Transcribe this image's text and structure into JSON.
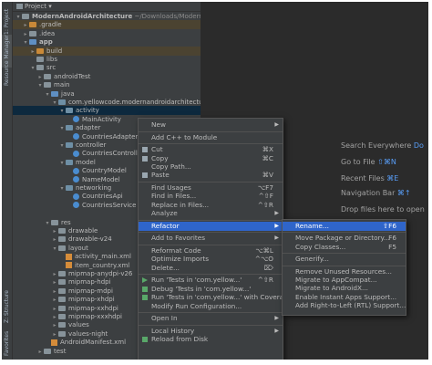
{
  "left_strip": {
    "project": "1: Project",
    "resource_manager": "Resource Manager",
    "structure": "Z: Structure",
    "favorites": "Favorites"
  },
  "panel": {
    "title": "Project"
  },
  "tree": [
    {
      "label": "ModernAndroidArchitecture",
      "extra": " ~/Downloads/ModernAndroid",
      "depth": 0,
      "arrow": "down",
      "icon": "folder",
      "bold": true
    },
    {
      "label": ".gradle",
      "depth": 1,
      "arrow": "right",
      "icon": "folder-orange",
      "dir": true
    },
    {
      "label": ".idea",
      "depth": 1,
      "arrow": "right",
      "icon": "folder"
    },
    {
      "label": "app",
      "depth": 1,
      "arrow": "down",
      "icon": "folder-blue",
      "bold": true
    },
    {
      "label": "build",
      "depth": 2,
      "arrow": "right",
      "icon": "folder-orange",
      "dir": true
    },
    {
      "label": "libs",
      "depth": 2,
      "arrow": "",
      "icon": "folder"
    },
    {
      "label": "src",
      "depth": 2,
      "arrow": "down",
      "icon": "folder"
    },
    {
      "label": "androidTest",
      "depth": 3,
      "arrow": "right",
      "icon": "folder"
    },
    {
      "label": "main",
      "depth": 3,
      "arrow": "down",
      "icon": "folder"
    },
    {
      "label": "java",
      "depth": 4,
      "arrow": "down",
      "icon": "folder-blue"
    },
    {
      "label": "com.yellowcode.modernandroidarchitecture",
      "depth": 5,
      "arrow": "down",
      "icon": "package"
    },
    {
      "label": "activity",
      "depth": 6,
      "arrow": "down",
      "icon": "package",
      "sel": true
    },
    {
      "label": "MainActivity",
      "depth": 7,
      "arrow": "",
      "icon": "class"
    },
    {
      "label": "adapter",
      "depth": 6,
      "arrow": "down",
      "icon": "package"
    },
    {
      "label": "CountriesAdapter",
      "depth": 7,
      "arrow": "",
      "icon": "class"
    },
    {
      "label": "controller",
      "depth": 6,
      "arrow": "down",
      "icon": "package"
    },
    {
      "label": "CountriesController",
      "depth": 7,
      "arrow": "",
      "icon": "class"
    },
    {
      "label": "model",
      "depth": 6,
      "arrow": "down",
      "icon": "package"
    },
    {
      "label": "CountryModel",
      "depth": 7,
      "arrow": "",
      "icon": "class"
    },
    {
      "label": "NameModel",
      "depth": 7,
      "arrow": "",
      "icon": "class"
    },
    {
      "label": "networking",
      "depth": 6,
      "arrow": "down",
      "icon": "package"
    },
    {
      "label": "CountriesApi",
      "depth": 7,
      "arrow": "",
      "icon": "class"
    },
    {
      "label": "CountriesService",
      "depth": 7,
      "arrow": "",
      "icon": "class"
    },
    {
      "label": "",
      "depth": 0,
      "arrow": "",
      "icon": ""
    },
    {
      "label": "res",
      "depth": 4,
      "arrow": "down",
      "icon": "folder"
    },
    {
      "label": "drawable",
      "depth": 5,
      "arrow": "right",
      "icon": "folder"
    },
    {
      "label": "drawable-v24",
      "depth": 5,
      "arrow": "right",
      "icon": "folder"
    },
    {
      "label": "layout",
      "depth": 5,
      "arrow": "down",
      "icon": "folder"
    },
    {
      "label": "activity_main.xml",
      "depth": 6,
      "arrow": "",
      "icon": "xml"
    },
    {
      "label": "item_country.xml",
      "depth": 6,
      "arrow": "",
      "icon": "xml"
    },
    {
      "label": "mipmap-anydpi-v26",
      "depth": 5,
      "arrow": "right",
      "icon": "folder"
    },
    {
      "label": "mipmap-hdpi",
      "depth": 5,
      "arrow": "right",
      "icon": "folder"
    },
    {
      "label": "mipmap-mdpi",
      "depth": 5,
      "arrow": "right",
      "icon": "folder"
    },
    {
      "label": "mipmap-xhdpi",
      "depth": 5,
      "arrow": "right",
      "icon": "folder"
    },
    {
      "label": "mipmap-xxhdpi",
      "depth": 5,
      "arrow": "right",
      "icon": "folder"
    },
    {
      "label": "mipmap-xxxhdpi",
      "depth": 5,
      "arrow": "right",
      "icon": "folder"
    },
    {
      "label": "values",
      "depth": 5,
      "arrow": "right",
      "icon": "folder"
    },
    {
      "label": "values-night",
      "depth": 5,
      "arrow": "right",
      "icon": "folder"
    },
    {
      "label": "AndroidManifest.xml",
      "depth": 4,
      "arrow": "",
      "icon": "xml"
    },
    {
      "label": "test",
      "depth": 3,
      "arrow": "right",
      "icon": "folder"
    }
  ],
  "editor_hints": [
    {
      "text": "Search Everywhere",
      "key": "Do"
    },
    {
      "text": "Go to File",
      "key": "⇧⌘N"
    },
    {
      "text": "Recent Files",
      "key": "⌘E"
    },
    {
      "text": "Navigation Bar",
      "key": "⌘↑"
    },
    {
      "text": "Drop files here to open",
      "key": ""
    }
  ],
  "context_menu": [
    {
      "label": "New",
      "shortcut": "",
      "sub": true
    },
    {
      "sep": true
    },
    {
      "label": "Add C++ to Module",
      "shortcut": ""
    },
    {
      "sep": true
    },
    {
      "label": "Cut",
      "shortcut": "⌘X",
      "icon": "cut"
    },
    {
      "label": "Copy",
      "shortcut": "⌘C",
      "icon": "copy"
    },
    {
      "label": "Copy Path...",
      "shortcut": ""
    },
    {
      "label": "Paste",
      "shortcut": "⌘V",
      "icon": "paste"
    },
    {
      "sep": true
    },
    {
      "label": "Find Usages",
      "shortcut": "⌥F7"
    },
    {
      "label": "Find in Files...",
      "shortcut": "^⇧F"
    },
    {
      "label": "Replace in Files...",
      "shortcut": "^⇧R"
    },
    {
      "label": "Analyze",
      "shortcut": "",
      "sub": true
    },
    {
      "sep": true
    },
    {
      "label": "Refactor",
      "shortcut": "",
      "sub": true,
      "hl": true
    },
    {
      "sep": true
    },
    {
      "label": "Add to Favorites",
      "shortcut": "",
      "sub": true
    },
    {
      "sep": true
    },
    {
      "label": "Reformat Code",
      "shortcut": "⌥⌘L"
    },
    {
      "label": "Optimize Imports",
      "shortcut": "^⌥O"
    },
    {
      "label": "Delete...",
      "shortcut": "⌦"
    },
    {
      "sep": true
    },
    {
      "label": "Run 'Tests in 'com.yellow...'",
      "shortcut": "^⇧R",
      "icon": "run"
    },
    {
      "label": "Debug 'Tests in 'com.yellow...'",
      "shortcut": "",
      "icon": "debug"
    },
    {
      "label": "Run 'Tests in 'com.yellow...' with Coverage",
      "shortcut": "",
      "icon": "coverage"
    },
    {
      "label": "Modify Run Configuration...",
      "shortcut": ""
    },
    {
      "sep": true
    },
    {
      "label": "Open In",
      "shortcut": "",
      "sub": true
    },
    {
      "sep": true
    },
    {
      "label": "Local History",
      "shortcut": "",
      "sub": true
    },
    {
      "label": "Reload from Disk",
      "shortcut": "",
      "icon": "reload"
    }
  ],
  "refactor_menu": [
    {
      "label": "Rename...",
      "shortcut": "⇧F6",
      "hl": true
    },
    {
      "sep": true
    },
    {
      "label": "Move Package or Directory...",
      "shortcut": "F6"
    },
    {
      "label": "Copy Classes...",
      "shortcut": "F5"
    },
    {
      "sep": true
    },
    {
      "label": "Generify...",
      "shortcut": ""
    },
    {
      "sep": true
    },
    {
      "label": "Remove Unused Resources...",
      "shortcut": ""
    },
    {
      "label": "Migrate to AppCompat...",
      "shortcut": ""
    },
    {
      "label": "Migrate to AndroidX...",
      "shortcut": ""
    },
    {
      "label": "Enable Instant Apps Support...",
      "shortcut": ""
    },
    {
      "label": "Add Right-to-Left (RTL) Support...",
      "shortcut": ""
    }
  ],
  "colors": {
    "accent": "#2f65ca",
    "background": "#2b2b2b",
    "panel": "#3c3f41"
  }
}
